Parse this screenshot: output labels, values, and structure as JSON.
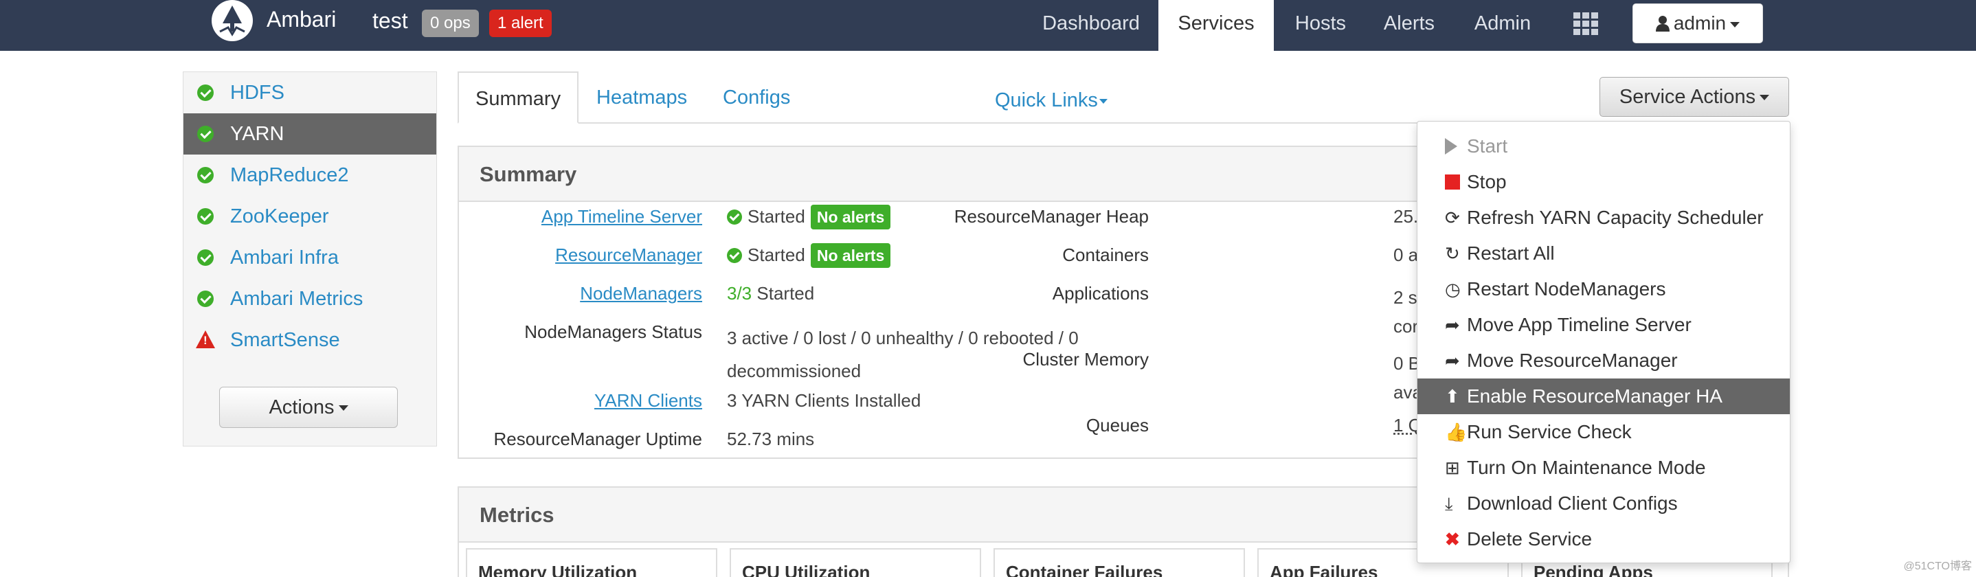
{
  "navbar": {
    "brand": "Ambari",
    "cluster_name": "test",
    "ops_badge": "0 ops",
    "alert_badge": "1 alert",
    "items": [
      "Dashboard",
      "Services",
      "Hosts",
      "Alerts",
      "Admin"
    ],
    "active_item": "Services",
    "user": "admin"
  },
  "sidebar": {
    "services": [
      {
        "label": "HDFS",
        "status": "ok"
      },
      {
        "label": "YARN",
        "status": "ok"
      },
      {
        "label": "MapReduce2",
        "status": "ok"
      },
      {
        "label": "ZooKeeper",
        "status": "ok"
      },
      {
        "label": "Ambari Infra",
        "status": "ok"
      },
      {
        "label": "Ambari Metrics",
        "status": "ok"
      },
      {
        "label": "SmartSense",
        "status": "alert"
      }
    ],
    "selected": "YARN",
    "actions_label": "Actions"
  },
  "tabs": {
    "items": [
      "Summary",
      "Heatmaps",
      "Configs"
    ],
    "active": "Summary",
    "quick_links": "Quick Links",
    "service_actions": "Service Actions"
  },
  "summary": {
    "title": "Summary",
    "app_timeline_server": {
      "label": "App Timeline Server",
      "status": "Started",
      "badge": "No alerts"
    },
    "resource_manager": {
      "label": "ResourceManager",
      "status": "Started",
      "badge": "No alerts"
    },
    "node_managers": {
      "label": "NodeManagers",
      "count": "3/3",
      "status": "Started"
    },
    "nm_status": {
      "label": "NodeManagers Status",
      "line1": "3 active / 0 lost / 0 unhealthy / 0 rebooted / 0",
      "line2": "decommissioned"
    },
    "yarn_clients": {
      "label": "YARN Clients",
      "value": "3 YARN Clients Installed"
    },
    "rm_uptime": {
      "label": "ResourceManager Uptime",
      "value": "52.73 mins"
    },
    "right": {
      "rm_heap": {
        "label": "ResourceManager Heap",
        "value": "25."
      },
      "containers": {
        "label": "Containers",
        "value": "0 a"
      },
      "applications": {
        "label": "Applications",
        "line1": "2 s",
        "line2": "cor"
      },
      "cluster_memory": {
        "label": "Cluster Memory",
        "line1": "0 B",
        "line2": "ava"
      },
      "queues": {
        "label": "Queues",
        "value": "1 Q"
      }
    }
  },
  "metrics": {
    "title": "Metrics",
    "cards": [
      "Memory Utilization",
      "CPU Utilization",
      "Container Failures",
      "App Failures",
      "Pending Apps"
    ]
  },
  "service_actions_menu": {
    "items": [
      {
        "label": "Start",
        "icon": "play-icon",
        "state": "disabled"
      },
      {
        "label": "Stop",
        "icon": "stop-icon",
        "state": "normal"
      },
      {
        "label": "Refresh YARN Capacity Scheduler",
        "icon": "refresh-icon",
        "state": "normal"
      },
      {
        "label": "Restart All",
        "icon": "restart-icon",
        "state": "normal"
      },
      {
        "label": "Restart NodeManagers",
        "icon": "clock-icon",
        "state": "normal"
      },
      {
        "label": "Move App Timeline Server",
        "icon": "share-icon",
        "state": "normal"
      },
      {
        "label": "Move ResourceManager",
        "icon": "share-icon",
        "state": "normal"
      },
      {
        "label": "Enable ResourceManager HA",
        "icon": "arrow-up-icon",
        "state": "hover"
      },
      {
        "label": "Run Service Check",
        "icon": "thumbs-up-icon",
        "state": "normal"
      },
      {
        "label": "Turn On Maintenance Mode",
        "icon": "medkit-icon",
        "state": "normal"
      },
      {
        "label": "Download Client Configs",
        "icon": "download-icon",
        "state": "normal"
      },
      {
        "label": "Delete Service",
        "icon": "delete-icon",
        "state": "normal"
      }
    ]
  },
  "watermark": "@51CTO博客",
  "colors": {
    "navbar": "#313d54",
    "link": "#2a8bc5",
    "ok": "#3fae2a",
    "alert": "#d9251d",
    "hover": "#666666"
  }
}
